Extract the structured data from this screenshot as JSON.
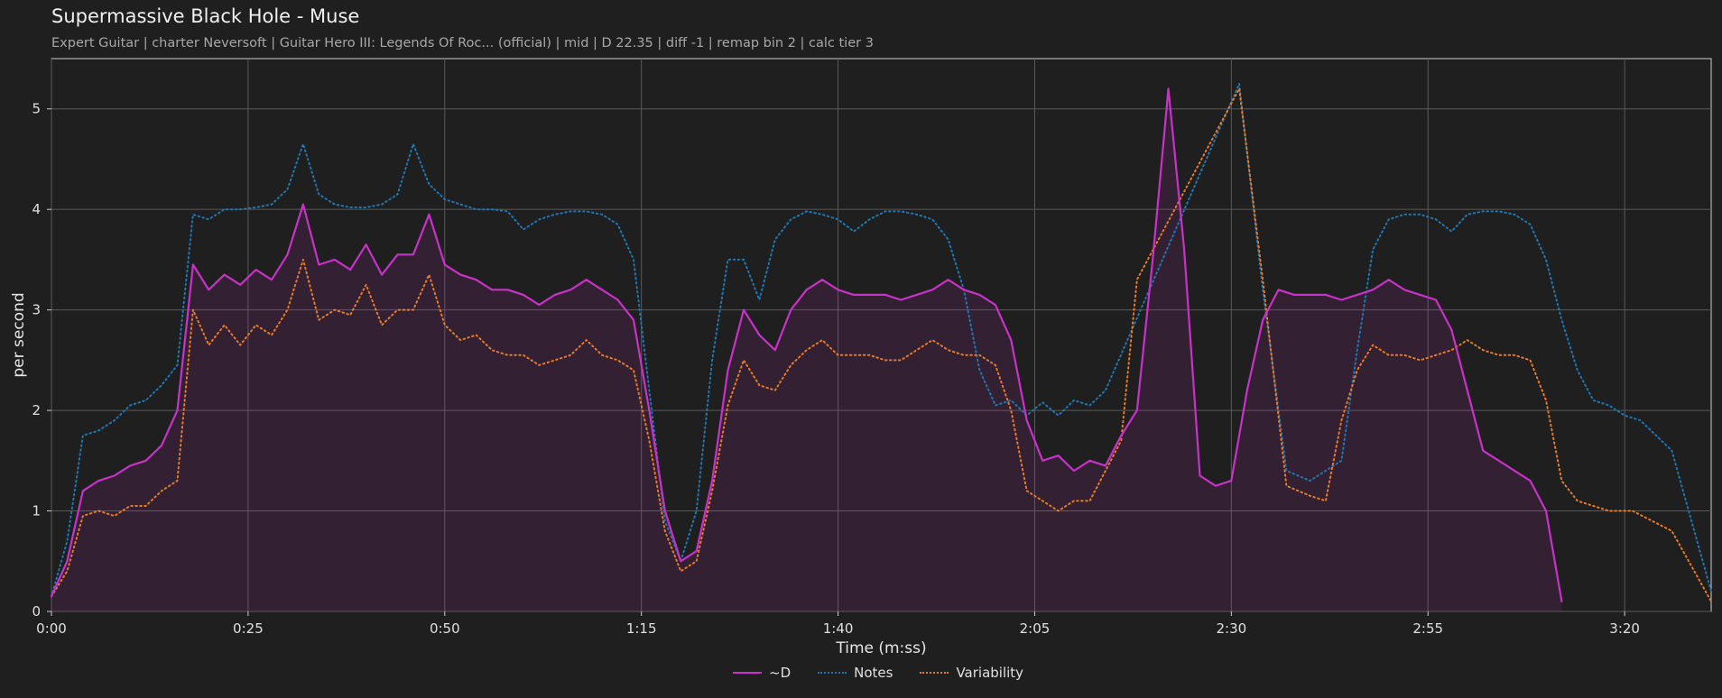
{
  "title": "Supermassive Black Hole - Muse",
  "subtitle": "Expert Guitar  |  charter Neversoft  |  Guitar Hero III: Legends Of Roc... (official)  |  mid  |  D 22.35  |  diff -1  |  remap bin 2  |  calc tier 3",
  "chart_data": {
    "type": "line",
    "xlabel": "Time (m:ss)",
    "ylabel": "per second",
    "xlim": [
      0,
      211
    ],
    "ylim": [
      0,
      5.5
    ],
    "grid": true,
    "legend_position": "bottom-center",
    "x_ticks": [
      {
        "value": 0,
        "label": "0:00"
      },
      {
        "value": 25,
        "label": "0:25"
      },
      {
        "value": 50,
        "label": "0:50"
      },
      {
        "value": 75,
        "label": "1:15"
      },
      {
        "value": 100,
        "label": "1:40"
      },
      {
        "value": 125,
        "label": "2:05"
      },
      {
        "value": 150,
        "label": "2:30"
      },
      {
        "value": 175,
        "label": "2:55"
      },
      {
        "value": 200,
        "label": "3:20"
      }
    ],
    "y_ticks": [
      0,
      1,
      2,
      3,
      4,
      5
    ],
    "x": [
      0,
      2,
      4,
      6,
      8,
      10,
      12,
      14,
      16,
      18,
      20,
      22,
      24,
      26,
      28,
      30,
      32,
      34,
      36,
      38,
      40,
      42,
      44,
      46,
      48,
      50,
      52,
      54,
      56,
      58,
      60,
      62,
      64,
      66,
      68,
      70,
      72,
      74,
      76,
      78,
      80,
      82,
      84,
      86,
      88,
      90,
      92,
      94,
      96,
      98,
      100,
      102,
      104,
      106,
      108,
      110,
      112,
      114,
      116,
      118,
      120,
      122,
      124,
      126,
      128,
      130,
      132,
      134,
      136,
      138,
      140,
      142,
      144,
      146,
      148,
      150,
      152,
      154,
      156,
      158,
      160,
      162,
      164,
      166,
      168,
      170,
      172,
      174,
      176,
      178,
      180,
      182,
      184,
      186,
      188,
      190,
      192,
      194,
      196,
      198,
      200,
      202,
      204,
      206,
      208,
      210,
      211
    ],
    "series": [
      {
        "name": "~D",
        "color": "#c832c8",
        "style": "solid",
        "values": [
          0.15,
          0.5,
          1.2,
          1.3,
          1.35,
          1.45,
          1.5,
          1.65,
          2.0,
          3.45,
          3.2,
          3.35,
          3.25,
          3.4,
          3.3,
          3.55,
          4.05,
          3.45,
          3.5,
          3.4,
          3.65,
          3.35,
          3.55,
          3.55,
          3.95,
          3.45,
          3.35,
          3.3,
          3.2,
          3.2,
          3.15,
          3.05,
          3.15,
          3.2,
          3.3,
          3.2,
          3.1,
          2.9,
          2.0,
          1.0,
          0.5,
          0.6,
          1.3,
          2.4,
          3.0,
          2.75,
          2.6,
          3.0,
          3.2,
          3.3,
          3.2,
          3.15,
          3.15,
          3.15,
          3.1,
          3.15,
          3.2,
          3.3,
          3.2,
          3.15,
          3.05,
          2.7,
          1.9,
          1.5,
          1.55,
          1.4,
          1.5,
          1.45,
          1.75,
          2.0,
          3.5,
          5.2,
          3.6,
          1.35,
          1.25,
          1.3,
          2.2,
          2.9,
          3.2,
          3.15,
          3.15,
          3.15,
          3.1,
          3.15,
          3.2,
          3.3,
          3.2,
          3.15,
          3.1,
          2.8,
          2.2,
          1.6,
          1.5,
          1.4,
          1.3,
          1.0,
          0.1
        ],
        "fill": true
      },
      {
        "name": "Notes",
        "color": "#1f77b4",
        "style": "dotted",
        "values": [
          0.15,
          0.7,
          1.75,
          1.8,
          1.9,
          2.05,
          2.1,
          2.25,
          2.45,
          3.95,
          3.9,
          4.0,
          4.0,
          4.02,
          4.05,
          4.2,
          4.65,
          4.15,
          4.05,
          4.02,
          4.02,
          4.05,
          4.15,
          4.65,
          4.25,
          4.1,
          4.05,
          4.0,
          4.0,
          3.98,
          3.8,
          3.9,
          3.95,
          3.98,
          3.98,
          3.95,
          3.85,
          3.5,
          2.2,
          0.9,
          0.5,
          1.0,
          2.5,
          3.5,
          3.5,
          3.1,
          3.7,
          3.9,
          3.98,
          3.95,
          3.9,
          3.78,
          3.9,
          3.98,
          3.98,
          3.95,
          3.9,
          3.7,
          3.2,
          2.4,
          2.05,
          2.1,
          1.95,
          2.08,
          1.95,
          2.1,
          2.05,
          2.2,
          5.25,
          3.2,
          1.4,
          1.3,
          1.4,
          1.5,
          2.6,
          3.6,
          3.9,
          3.95,
          3.95,
          3.9,
          3.78,
          3.95,
          3.98,
          3.98,
          3.95,
          3.85,
          3.5,
          2.9,
          2.4,
          2.1,
          2.05,
          1.95,
          1.9,
          1.6,
          0.2
        ],
        "x": [
          0,
          2,
          4,
          6,
          8,
          10,
          12,
          14,
          16,
          18,
          20,
          22,
          24,
          26,
          28,
          30,
          32,
          34,
          36,
          38,
          40,
          42,
          44,
          46,
          48,
          50,
          52,
          54,
          56,
          58,
          60,
          62,
          64,
          66,
          68,
          70,
          72,
          74,
          76,
          78,
          80,
          82,
          84,
          86,
          88,
          90,
          92,
          94,
          96,
          98,
          100,
          102,
          104,
          106,
          108,
          110,
          112,
          114,
          116,
          118,
          120,
          122,
          124,
          126,
          128,
          130,
          132,
          134,
          151,
          154,
          157,
          160,
          162,
          164,
          166,
          168,
          170,
          172,
          174,
          176,
          178,
          180,
          182,
          184,
          186,
          188,
          190,
          192,
          194,
          196,
          198,
          200,
          202,
          206,
          211
        ]
      },
      {
        "name": "Variability",
        "color": "#e87a2a",
        "style": "dotted",
        "values": [
          0.15,
          0.4,
          0.95,
          1.0,
          0.95,
          1.05,
          1.05,
          1.2,
          1.3,
          3.0,
          2.65,
          2.85,
          2.65,
          2.85,
          2.75,
          3.0,
          3.5,
          2.9,
          3.0,
          2.95,
          3.25,
          2.85,
          3.0,
          3.0,
          3.35,
          2.85,
          2.7,
          2.75,
          2.6,
          2.55,
          2.55,
          2.45,
          2.5,
          2.55,
          2.7,
          2.55,
          2.5,
          2.4,
          1.7,
          0.8,
          0.4,
          0.5,
          1.2,
          2.05,
          2.5,
          2.25,
          2.2,
          2.45,
          2.6,
          2.7,
          2.55,
          2.55,
          2.55,
          2.5,
          2.5,
          2.6,
          2.7,
          2.6,
          2.55,
          2.55,
          2.45,
          2.0,
          1.2,
          1.1,
          1.0,
          1.1,
          1.1,
          1.4,
          1.7,
          3.3,
          5.2,
          3.3,
          1.25,
          1.15,
          1.1,
          1.9,
          2.4,
          2.65,
          2.55,
          2.55,
          2.5,
          2.55,
          2.6,
          2.7,
          2.6,
          2.55,
          2.55,
          2.5,
          2.1,
          1.3,
          1.1,
          1.0,
          1.0,
          0.8,
          0.1
        ],
        "x": [
          0,
          2,
          4,
          6,
          8,
          10,
          12,
          14,
          16,
          18,
          20,
          22,
          24,
          26,
          28,
          30,
          32,
          34,
          36,
          38,
          40,
          42,
          44,
          46,
          48,
          50,
          52,
          54,
          56,
          58,
          60,
          62,
          64,
          66,
          68,
          70,
          72,
          74,
          76,
          78,
          80,
          82,
          84,
          86,
          88,
          90,
          92,
          94,
          96,
          98,
          100,
          102,
          104,
          106,
          108,
          110,
          112,
          114,
          116,
          118,
          120,
          122,
          124,
          126,
          128,
          130,
          132,
          134,
          136,
          138,
          151,
          154,
          157,
          160,
          162,
          164,
          166,
          168,
          170,
          172,
          174,
          176,
          178,
          180,
          182,
          184,
          186,
          188,
          190,
          192,
          194,
          198,
          201,
          206,
          211
        ]
      }
    ]
  }
}
